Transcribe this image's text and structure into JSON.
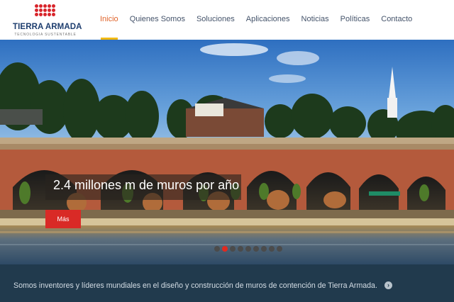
{
  "brand": {
    "name": "TIERRA ARMADA",
    "tagline": "TECNOLOGIA SUSTENTABLE",
    "accent": "#d8252b",
    "navy": "#1d3d6e"
  },
  "nav": {
    "items": [
      {
        "label": "Inicio",
        "active": true
      },
      {
        "label": "Quienes Somos",
        "active": false
      },
      {
        "label": "Soluciones",
        "active": false
      },
      {
        "label": "Aplicaciones",
        "active": false
      },
      {
        "label": "Noticias",
        "active": false
      },
      {
        "label": "Políticas",
        "active": false
      },
      {
        "label": "Contacto",
        "active": false
      }
    ],
    "active_color": "#e0632a",
    "underline_color": "#f2b90f"
  },
  "hero": {
    "headline": "2.4 millones m de muros por año",
    "button_label": "Más",
    "button_color": "#d92a26",
    "slide_count": 9,
    "active_slide": 2
  },
  "band": {
    "text": "Somos inventores y líderes mundiales en el diseño y construcción de muros de contención de Tierra Armada.",
    "arrow_icon": "chevron-right-icon",
    "background": "#213a4d"
  }
}
